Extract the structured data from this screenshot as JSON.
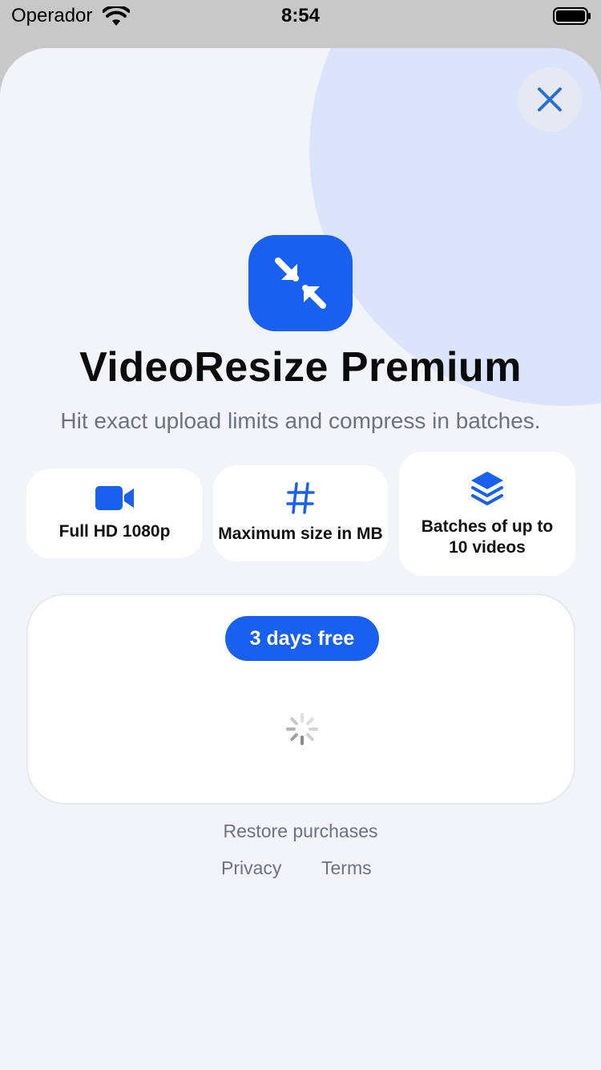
{
  "status_bar": {
    "carrier": "Operador",
    "time": "8:54"
  },
  "header": {
    "title": "VideoResize Premium",
    "subtitle": "Hit exact upload limits and compress in batches."
  },
  "features": [
    {
      "icon": "video-camera-icon",
      "label": "Full HD 1080p"
    },
    {
      "icon": "hashtag-icon",
      "label": "Maximum size in MB"
    },
    {
      "icon": "layers-stack-icon",
      "label": "Batches of up to 10 videos"
    }
  ],
  "pricing": {
    "trial_badge": "3 days free",
    "loading": true
  },
  "footer": {
    "restore": "Restore purchases",
    "privacy": "Privacy",
    "terms": "Terms"
  },
  "colors": {
    "accent": "#1760f0",
    "sheet_background": "#f3f4f9",
    "decor_circle": "#dbe4fb",
    "muted_text": "#6b7280"
  }
}
